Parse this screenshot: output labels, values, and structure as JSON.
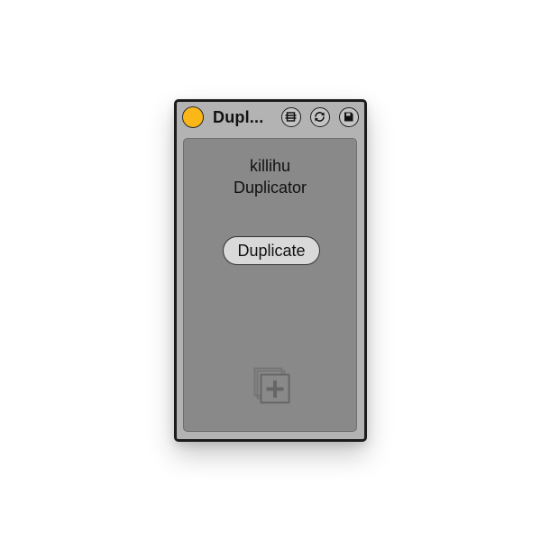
{
  "device": {
    "title": "Dupl...",
    "power_color": "#fbb717",
    "icons": {
      "map": "map-icon",
      "reload": "reload-icon",
      "save": "save-icon",
      "add": "add-copy-icon"
    }
  },
  "panel": {
    "heading_line1": "killihu",
    "heading_line2": "Duplicator",
    "button_label": "Duplicate"
  }
}
